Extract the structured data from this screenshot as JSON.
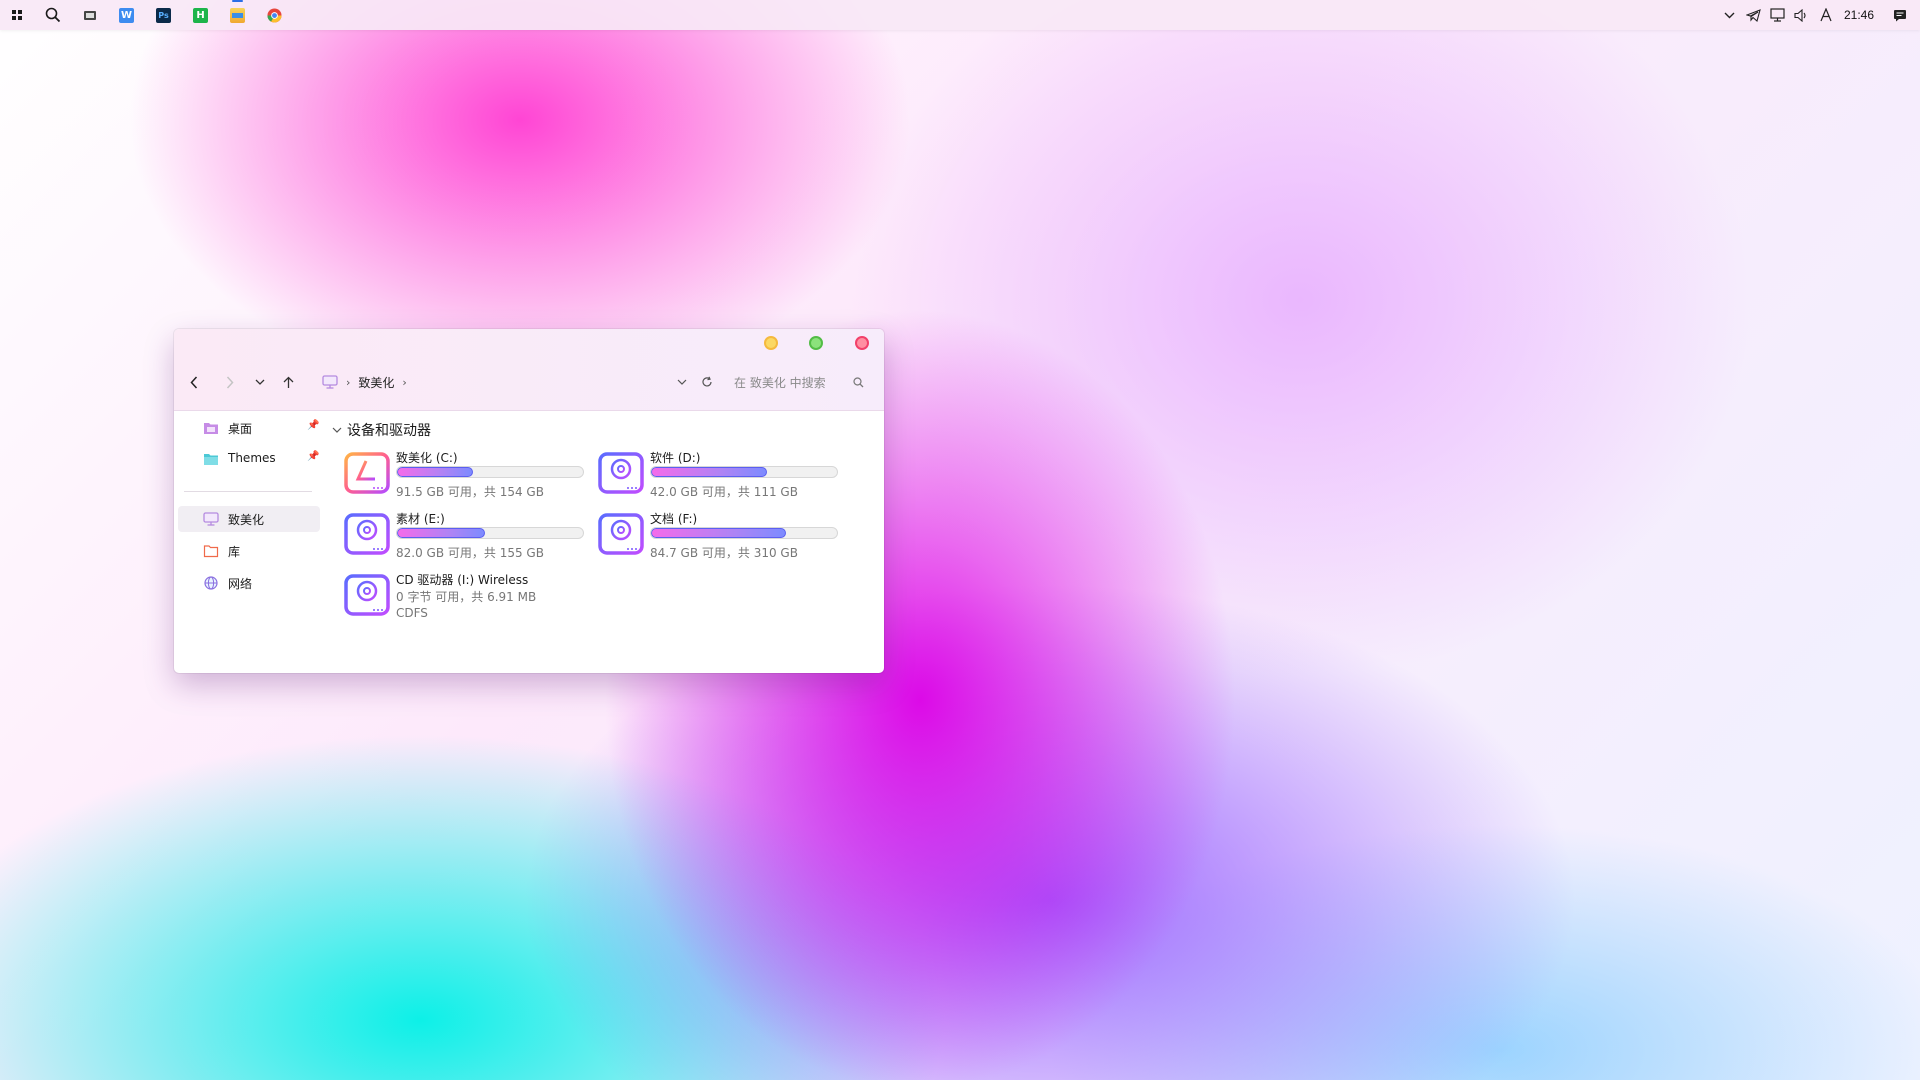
{
  "taskbar": {
    "apps": [
      {
        "name": "start-icon"
      },
      {
        "name": "search-icon"
      },
      {
        "name": "taskview-icon"
      },
      {
        "name": "wps-writer-app-icon",
        "glyph": "W",
        "color": "#3d8cf0"
      },
      {
        "name": "photoshop-app-icon",
        "glyph": "Ps",
        "color": "#0b2a4a"
      },
      {
        "name": "hbuilder-app-icon",
        "glyph": "H",
        "color": "#1db44b"
      },
      {
        "name": "file-explorer-app-icon",
        "color": "#f5c542"
      },
      {
        "name": "chrome-app-icon",
        "color": "#e7453c"
      }
    ],
    "tray": [
      "chevron-up-icon",
      "telegram-icon",
      "network-icon",
      "volume-icon",
      "ime-icon"
    ],
    "time": "21:46"
  },
  "window": {
    "breadcrumb": "致美化",
    "search_placeholder": "在 致美化 中搜索",
    "sidebar": {
      "pinned": [
        {
          "label": "桌面",
          "icon": "desktop-folder-icon",
          "color": "#c68ce6"
        },
        {
          "label": "Themes",
          "icon": "folder-icon",
          "color": "#4cc9d6"
        }
      ],
      "locations": [
        {
          "label": "致美化",
          "icon": "this-pc-icon",
          "selected": true
        },
        {
          "label": "库",
          "icon": "library-icon"
        },
        {
          "label": "网络",
          "icon": "network-globe-icon"
        }
      ]
    },
    "group_title": "设备和驱动器",
    "drives": [
      {
        "name": "致美化 (C:)",
        "info": "91.5 GB 可用，共 154 GB",
        "used_fraction": 0.406,
        "icon": "system-drive-icon"
      },
      {
        "name": "软件 (D:)",
        "info": "42.0 GB 可用，共 111 GB",
        "used_fraction": 0.622,
        "icon": "disk-drive-icon"
      },
      {
        "name": "素材 (E:)",
        "info": "82.0 GB 可用，共 155 GB",
        "used_fraction": 0.471,
        "icon": "disk-drive-icon"
      },
      {
        "name": "文档 (F:)",
        "info": "84.7 GB 可用，共 310 GB",
        "used_fraction": 0.727,
        "icon": "disk-drive-icon"
      },
      {
        "name": "CD 驱动器 (I:) Wireless",
        "info": "0 字节 可用，共 6.91 MB",
        "fs": "CDFS",
        "icon": "cd-drive-icon"
      }
    ]
  }
}
